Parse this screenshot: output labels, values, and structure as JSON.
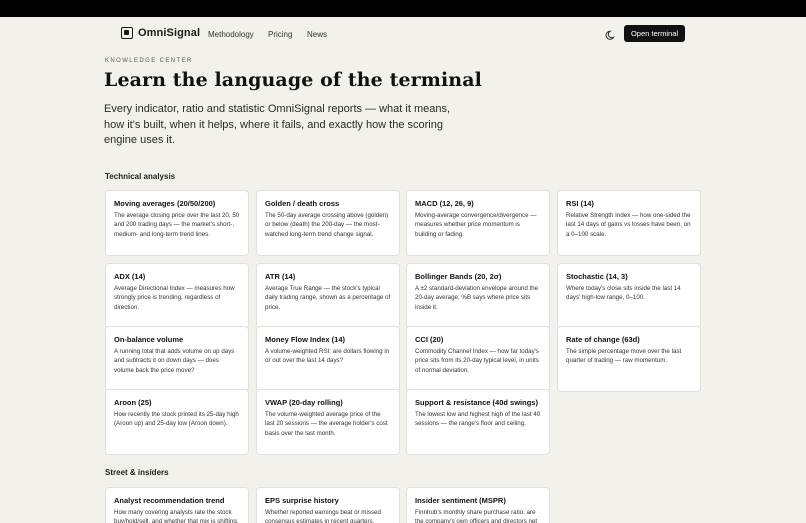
{
  "nav": {
    "brand": "OmniSignal",
    "links": [
      "Methodology",
      "Pricing",
      "News"
    ],
    "cta": "Open terminal"
  },
  "hero": {
    "eyebrow": "KNOWLEDGE CENTER",
    "title": "Learn the language of the terminal",
    "lede": "Every indicator, ratio and statistic OmniSignal reports — what it means, how it's built, when it helps, where it fails, and exactly how the scoring engine uses it."
  },
  "sections": [
    {
      "title": "Technical analysis",
      "cards": [
        {
          "title": "Moving averages (20/50/200)",
          "desc": "The average closing price over the last 20, 50 and 200 trading days — the market's short-, medium- and long-term trend lines."
        },
        {
          "title": "Golden / death cross",
          "desc": "The 50-day average crossing above (golden) or below (death) the 200-day — the most-watched long-term trend change signal."
        },
        {
          "title": "MACD (12, 26, 9)",
          "desc": "Moving-average convergence/divergence — measures whether price momentum is building or fading."
        },
        {
          "title": "RSI (14)",
          "desc": "Relative Strength Index — how one-sided the last 14 days of gains vs losses have been, on a 0–100 scale."
        },
        {
          "title": "ADX (14)",
          "desc": "Average Directional Index — measures how strongly price is trending, regardless of direction."
        },
        {
          "title": "ATR (14)",
          "desc": "Average True Range — the stock's typical daily trading range, shown as a percentage of price."
        },
        {
          "title": "Bollinger Bands (20, 2σ)",
          "desc": "A ±2 standard-deviation envelope around the 20-day average; %B says where price sits inside it."
        },
        {
          "title": "Stochastic (14, 3)",
          "desc": "Where today's close sits inside the last 14 days' high-low range, 0–100."
        },
        {
          "title": "On-balance volume",
          "desc": "A running total that adds volume on up days and subtracts it on down days — does volume back the price move?"
        },
        {
          "title": "Money Flow Index (14)",
          "desc": "A volume-weighted RSI: are dollars flowing in or out over the last 14 days?"
        },
        {
          "title": "CCI (20)",
          "desc": "Commodity Channel Index — how far today's price sits from its 20-day typical level, in units of normal deviation."
        },
        {
          "title": "Rate of change (63d)",
          "desc": "The simple percentage move over the last quarter of trading — raw momentum."
        },
        {
          "title": "Aroon (25)",
          "desc": "How recently the stock printed its 25-day high (Aroon up) and 25-day low (Aroon down)."
        },
        {
          "title": "VWAP (20-day rolling)",
          "desc": "The volume-weighted average price of the last 20 sessions — the average holder's cost basis over the last month."
        },
        {
          "title": "Support & resistance (40d swings)",
          "desc": "The lowest low and highest high of the last 40 sessions — the range's floor and ceiling."
        }
      ]
    },
    {
      "title": "Street & insiders",
      "cards": [
        {
          "title": "Analyst recommendation trend",
          "desc": "How many covering analysts rate the stock buy/hold/sell, and whether that mix is shifting."
        },
        {
          "title": "EPS surprise history",
          "desc": "Whether reported earnings beat or missed consensus estimates in recent quarters."
        },
        {
          "title": "Insider sentiment (MSPR)",
          "desc": "Finnhub's monthly share purchase ratio: are the company's own officers and directors net buyers?"
        }
      ]
    }
  ]
}
